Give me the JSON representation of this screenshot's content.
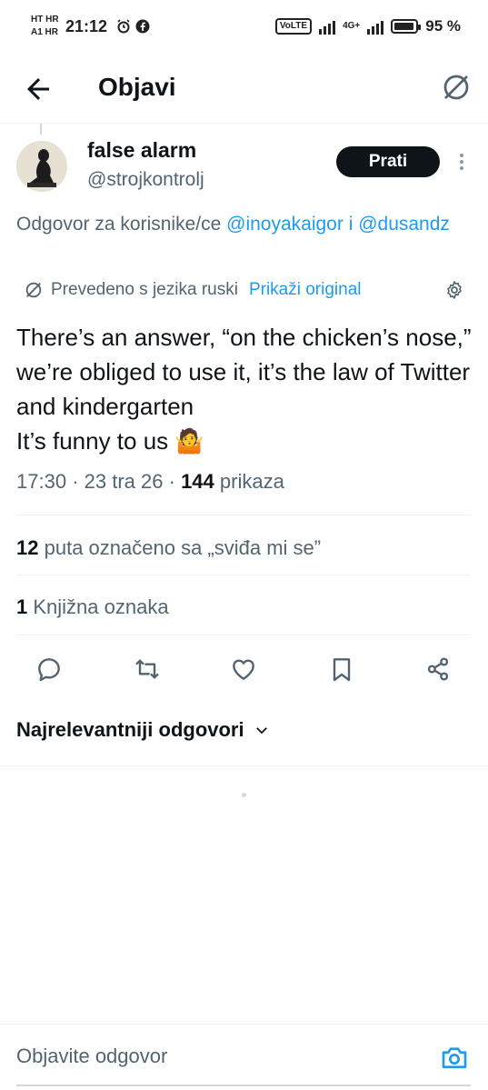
{
  "status_bar": {
    "carrier_1": "HT HR",
    "carrier_2": "A1 HR",
    "time": "21:12",
    "volte": "VoLTE",
    "network": "4G+",
    "battery": "95 %",
    "battery_level": 0.95
  },
  "header": {
    "title": "Objavi",
    "back_icon": "arrow-left-icon",
    "grok_icon": "grok-icon"
  },
  "author": {
    "name": "false alarm",
    "handle": "@strojkontrolj",
    "follow_label": "Prati"
  },
  "replying": {
    "prefix": "Odgovor za korisnike/ce",
    "user1": "@inoyakaigor",
    "conj": "i",
    "user2": "@dusandz"
  },
  "translation": {
    "note": "Prevedeno s jezika ruski",
    "show_original": "Prikaži original"
  },
  "tweet": {
    "line1": "There’s an answer, “on the chicken’s nose,” we’re obliged to use it, it’s the law of Twitter and kindergarten",
    "line2": "It’s funny to us 🤷",
    "time": "17:30",
    "date": "23 tra 26",
    "views_count": "144",
    "views_label": "prikaza"
  },
  "stats": {
    "likes_count": "12",
    "likes_label": "puta označeno sa „sviđa mi se”",
    "bookmarks_count": "1",
    "bookmarks_label": "Knjižna oznaka"
  },
  "actions": [
    "reply-icon",
    "retweet-icon",
    "like-icon",
    "bookmark-icon",
    "share-icon"
  ],
  "replies": {
    "sort_label": "Najrelevantniji odgovori"
  },
  "compose": {
    "placeholder": "Objavite odgovor"
  },
  "colors": {
    "accent": "#1d9bf0",
    "text": "#0f1419",
    "secondary": "#536471"
  }
}
